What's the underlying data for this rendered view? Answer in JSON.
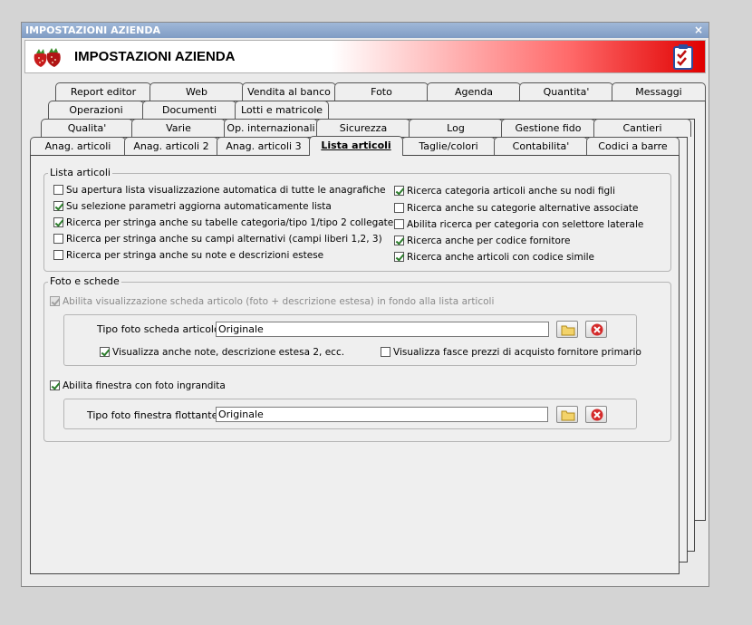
{
  "window": {
    "title": "IMPOSTAZIONI AZIENDA",
    "close_glyph": "×",
    "header_title": "IMPOSTAZIONI AZIENDA",
    "logo_icon": "strawberries-icon",
    "header_icon": "checklist-icon"
  },
  "tabs": {
    "row1": [
      "Report editor",
      "Web",
      "Vendita al banco",
      "Foto",
      "Agenda",
      "Quantita'",
      "Messaggi"
    ],
    "row2": [
      "Operazioni",
      "Documenti",
      "Lotti e matricole"
    ],
    "row3": [
      "Qualita'",
      "Varie",
      "Op. internazionali",
      "Sicurezza",
      "Log",
      "Gestione fido",
      "Cantieri"
    ],
    "row4": [
      "Anag. articoli",
      "Anag. articoli 2",
      "Anag. articoli 3",
      "Lista articoli",
      "Taglie/colori",
      "Contabilita'",
      "Codici a barre"
    ],
    "active": "Lista articoli"
  },
  "lista_articoli": {
    "label": "Lista articoli",
    "left": [
      {
        "label": "Su apertura lista visualizzazione automatica di tutte le anagrafiche",
        "checked": false
      },
      {
        "label": "Su selezione parametri aggiorna automaticamente lista",
        "checked": true
      },
      {
        "label": "Ricerca per stringa anche su tabelle categoria/tipo 1/tipo 2 collegate",
        "checked": true
      },
      {
        "label": "Ricerca per stringa anche su campi alternativi (campi liberi 1,2, 3)",
        "checked": false
      },
      {
        "label": "Ricerca per stringa anche su note e descrizioni estese",
        "checked": false
      }
    ],
    "right": [
      {
        "label": "Ricerca categoria articoli anche su nodi figli",
        "checked": true
      },
      {
        "label": "Ricerca anche su categorie alternative associate",
        "checked": false
      },
      {
        "label": "Abilita ricerca per categoria con selettore laterale",
        "checked": false
      },
      {
        "label": "Ricerca anche per codice fornitore",
        "checked": true
      },
      {
        "label": "Ricerca anche articoli con codice simile",
        "checked": true
      }
    ]
  },
  "foto_schede": {
    "label": "Foto e schede",
    "abilita_scheda": {
      "label": "Abilita visualizzazione scheda articolo (foto + descrizione estesa) in fondo alla lista articoli",
      "checked": true,
      "disabled": true
    },
    "tipo_foto_scheda": {
      "label": "Tipo foto scheda articolo :",
      "value": "Originale"
    },
    "visualizza_note": {
      "label": "Visualizza anche note, descrizione estesa 2, ecc.",
      "checked": true
    },
    "visualizza_fasce": {
      "label": "Visualizza fasce prezzi di acquisto fornitore primario",
      "checked": false
    },
    "abilita_finestra": {
      "label": "Abilita finestra con foto ingrandita",
      "checked": true
    },
    "tipo_foto_finestra": {
      "label": "Tipo foto finestra flottante :",
      "value": "Originale"
    },
    "browse_icon": "folder-icon",
    "clear_icon": "delete-icon"
  }
}
